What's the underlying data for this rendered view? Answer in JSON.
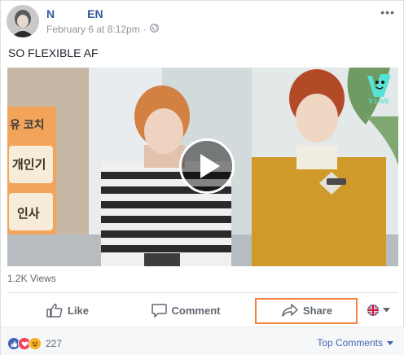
{
  "post": {
    "author_first": "N",
    "author_last": "EN",
    "timestamp": "February 6 at 8:12pm",
    "separator": "·",
    "privacy_icon": "globe-icon",
    "text": "SO FLEXIBLE AF"
  },
  "video": {
    "views": "1.2K Views",
    "overlay_logo": "V LIVE",
    "board_text": [
      "유 코치",
      "개인기",
      "인사"
    ]
  },
  "actions": {
    "like": "Like",
    "comment": "Comment",
    "share": "Share"
  },
  "footer": {
    "reaction_count": "227",
    "top_comments": "Top Comments"
  },
  "colors": {
    "link": "#365899",
    "highlight": "#f5833d",
    "like_blue": "#4267b2"
  }
}
